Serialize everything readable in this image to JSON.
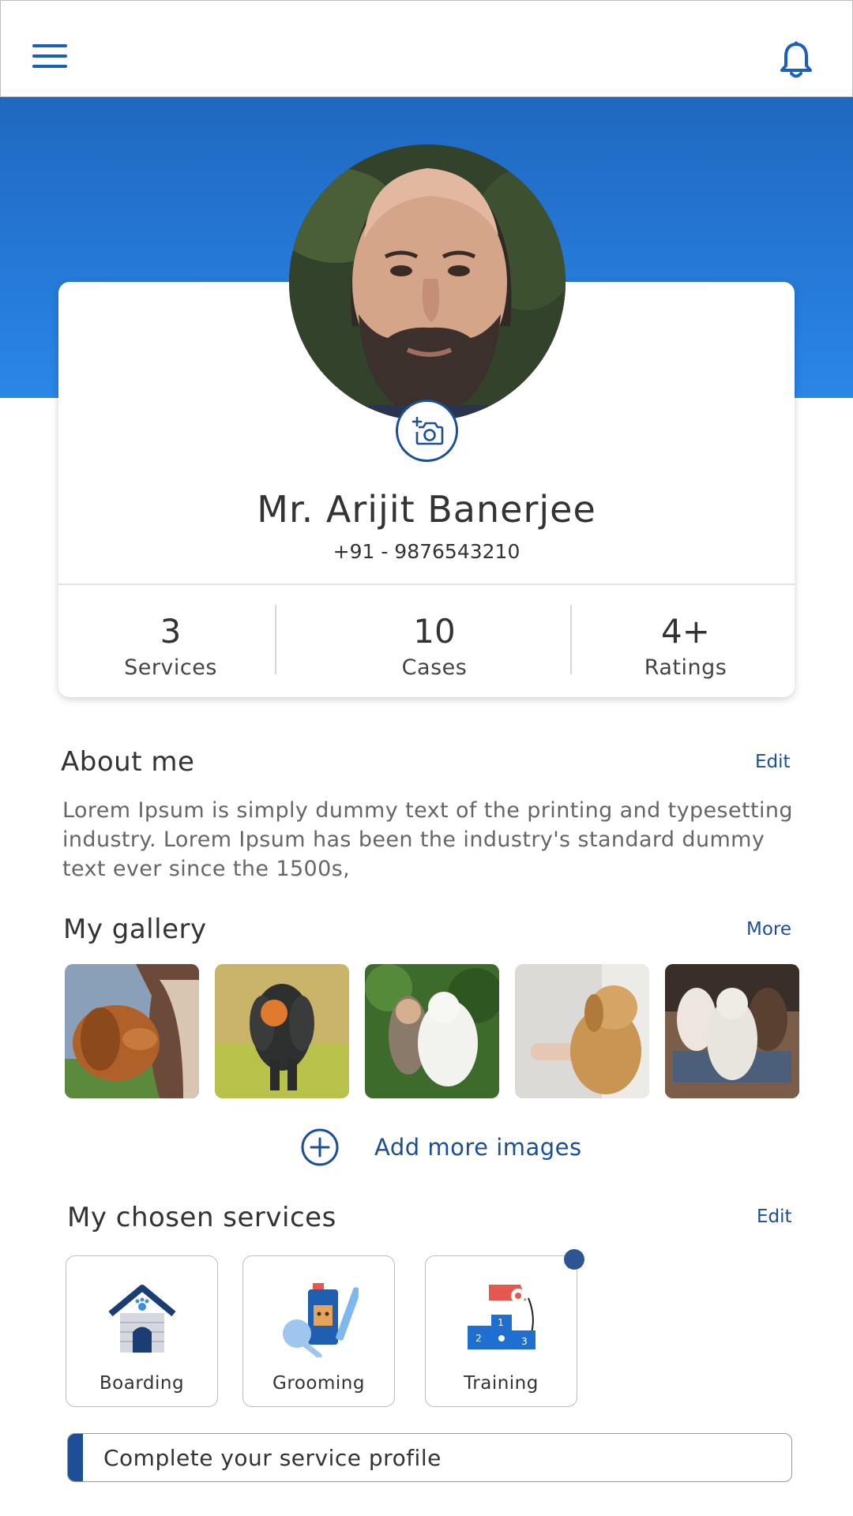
{
  "colors": {
    "primary": "#1c4f96",
    "banner_top": "#1f68c0",
    "banner_bottom": "#2a86e8",
    "text_dark": "#333333",
    "text_muted": "#666666"
  },
  "header": {
    "menu_icon": "hamburger-menu-icon",
    "notification_icon": "bell-icon"
  },
  "profile": {
    "name": "Mr. Arijit Banerjee",
    "phone": "+91 - 9876543210",
    "camera_icon": "add-photo-camera-icon"
  },
  "stats": [
    {
      "value": "3",
      "label": "Services"
    },
    {
      "value": "10",
      "label": "Cases"
    },
    {
      "value": "4+",
      "label": "Ratings"
    }
  ],
  "about": {
    "title": "About me",
    "edit_label": "Edit",
    "text": "Lorem Ipsum is simply dummy text of the printing and typesetting industry. Lorem Ipsum has been the industry's standard dummy text ever since the 1500s,"
  },
  "gallery": {
    "title": "My gallery",
    "more_label": "More",
    "add_label": "Add more images"
  },
  "services": {
    "title": "My chosen services",
    "edit_label": "Edit",
    "items": [
      {
        "label": "Boarding",
        "icon": "dog-house-icon"
      },
      {
        "label": "Grooming",
        "icon": "grooming-kit-icon"
      },
      {
        "label": "Training",
        "icon": "training-podium-whistle-icon"
      }
    ]
  },
  "complete_profile": {
    "label": "Complete your service profile"
  }
}
